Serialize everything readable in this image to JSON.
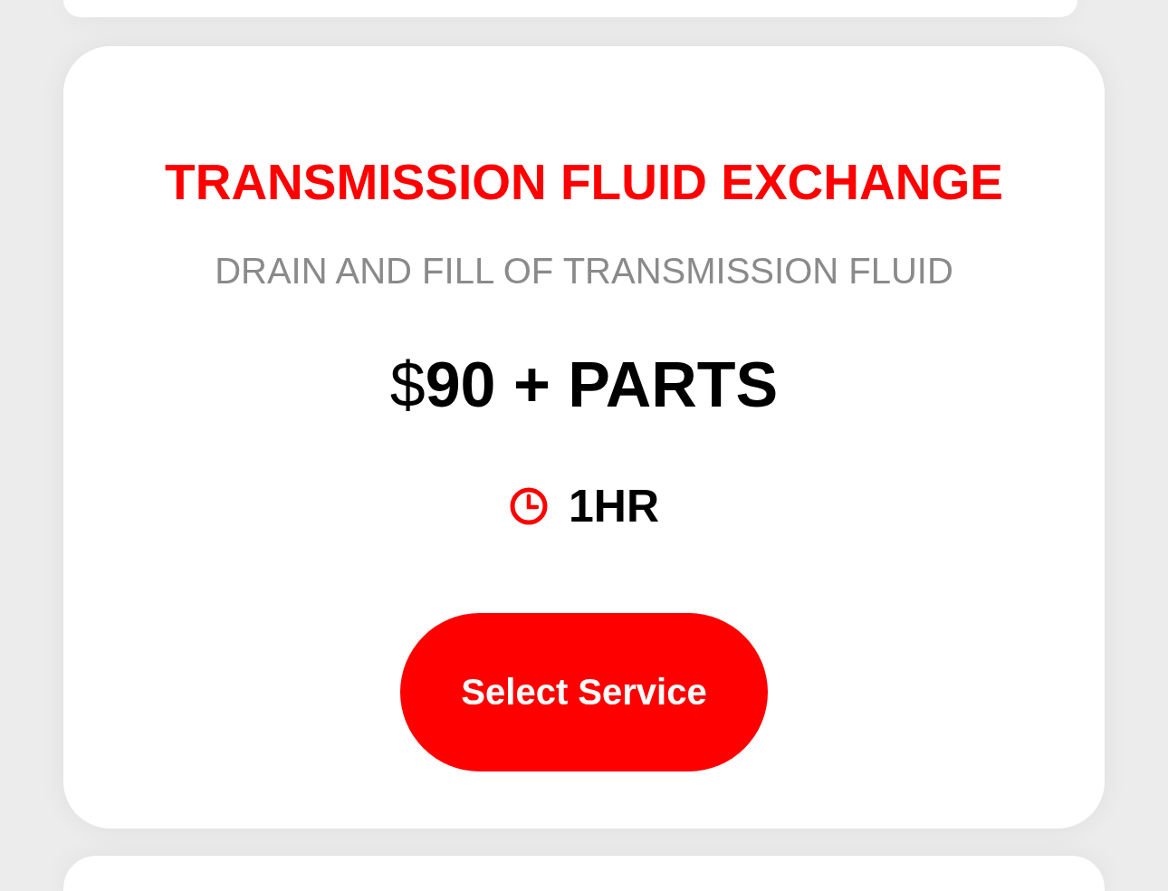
{
  "service_card": {
    "title": "TRANSMISSION FLUID EXCHANGE",
    "description": "DRAIN AND FILL OF TRANSMISSION FLUID",
    "price": "$**90 + PARTS**",
    "duration": "1HR",
    "button": "Select Service"
  }
}
